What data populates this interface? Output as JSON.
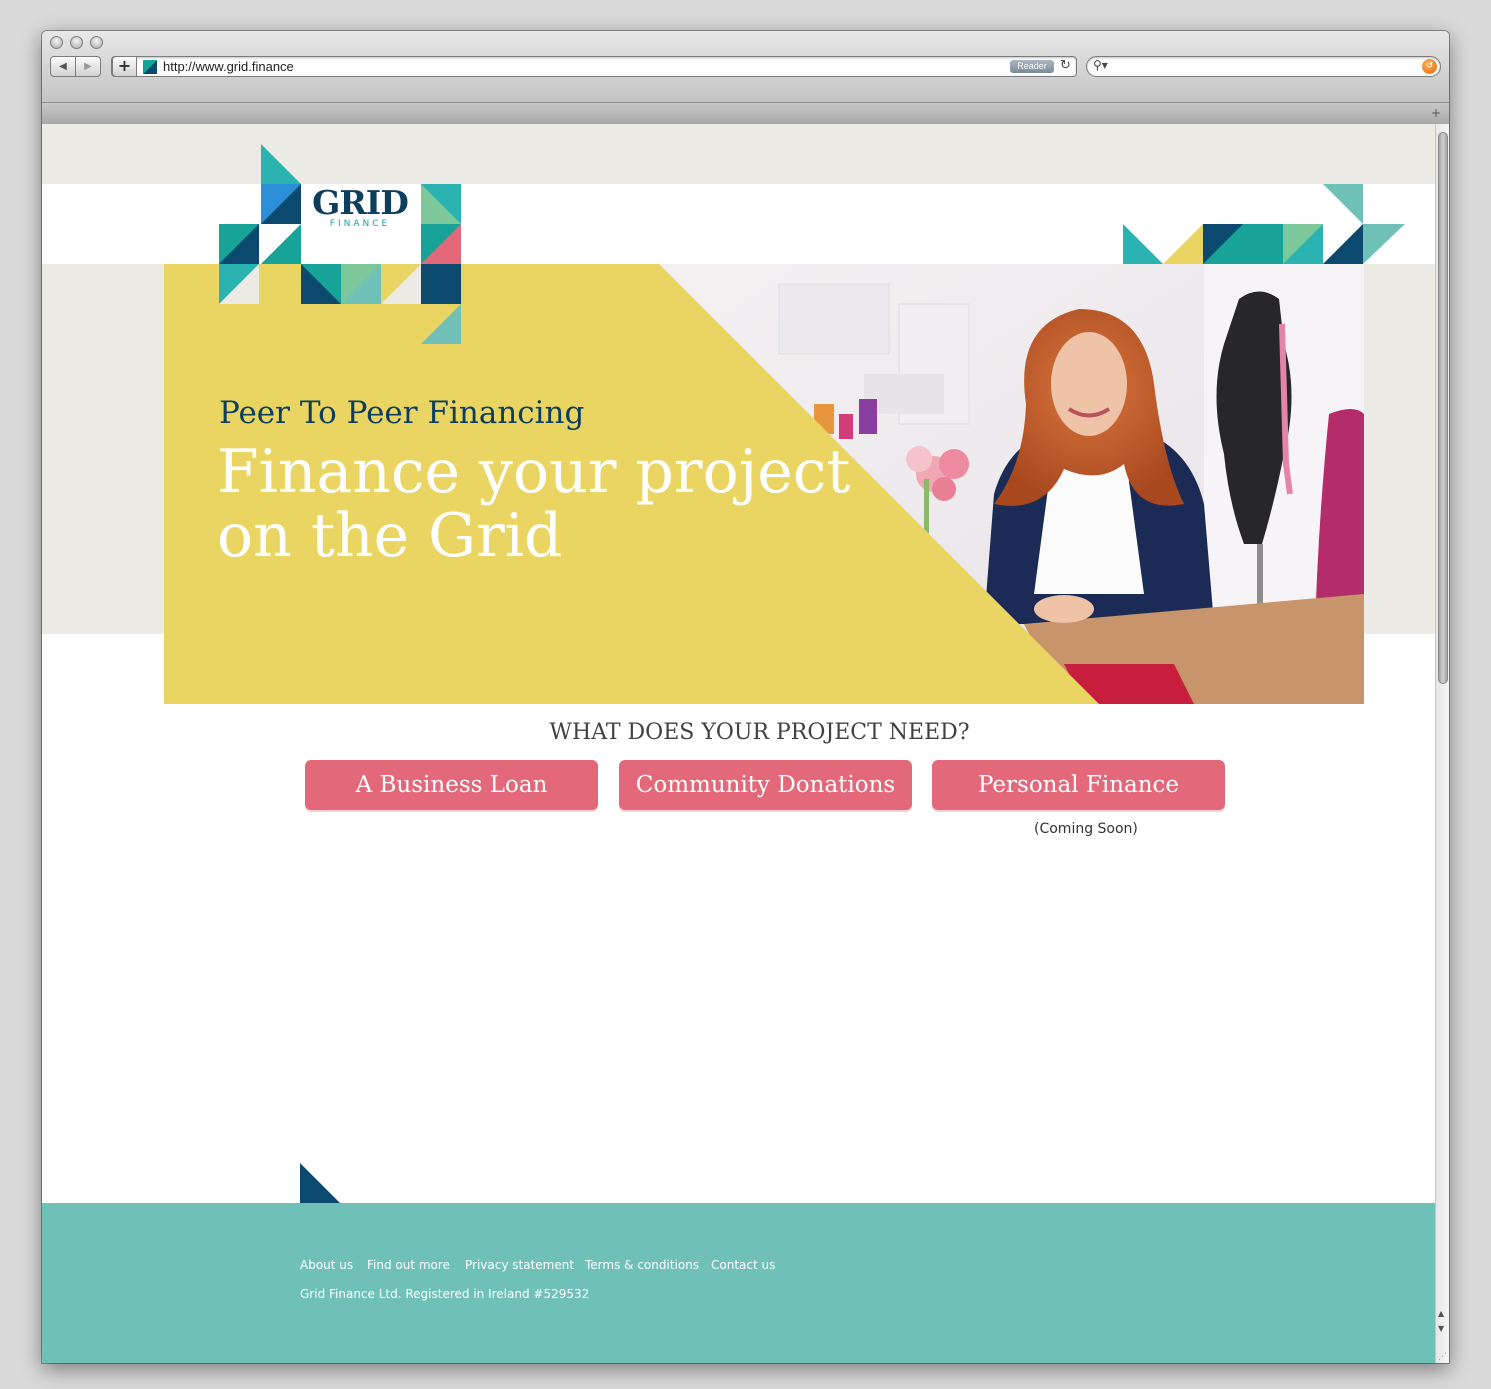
{
  "browser": {
    "url": "http://www.grid.finance",
    "reader_label": "Reader",
    "search_placeholder": ""
  },
  "logo": {
    "word": "GRID",
    "sub": "FINANCE"
  },
  "hero": {
    "subtitle": "Peer To Peer Financing",
    "title": "Finance your project on the Grid"
  },
  "main": {
    "question": "WHAT DOES YOUR PROJECT NEED?",
    "buttons": [
      {
        "label": "A Business Loan"
      },
      {
        "label": "Community Donations"
      },
      {
        "label": "Personal Finance"
      }
    ],
    "coming_soon": "(Coming Soon)"
  },
  "footer": {
    "links": [
      {
        "label": "About us"
      },
      {
        "label": "Find out more"
      },
      {
        "label": "Privacy statement"
      },
      {
        "label": "Terms & conditions"
      },
      {
        "label": "Contact us"
      }
    ],
    "note": "Grid Finance Ltd. Registered in Ireland #529532"
  },
  "colors": {
    "teal": "#2bb3b1",
    "dark_navy": "#0b4a6e",
    "green": "#17a398",
    "light_green": "#7cc89a",
    "blue": "#2a8fd6",
    "pink": "#e3697a",
    "yellow": "#ead563",
    "footer_bg": "#6fc1b7"
  }
}
